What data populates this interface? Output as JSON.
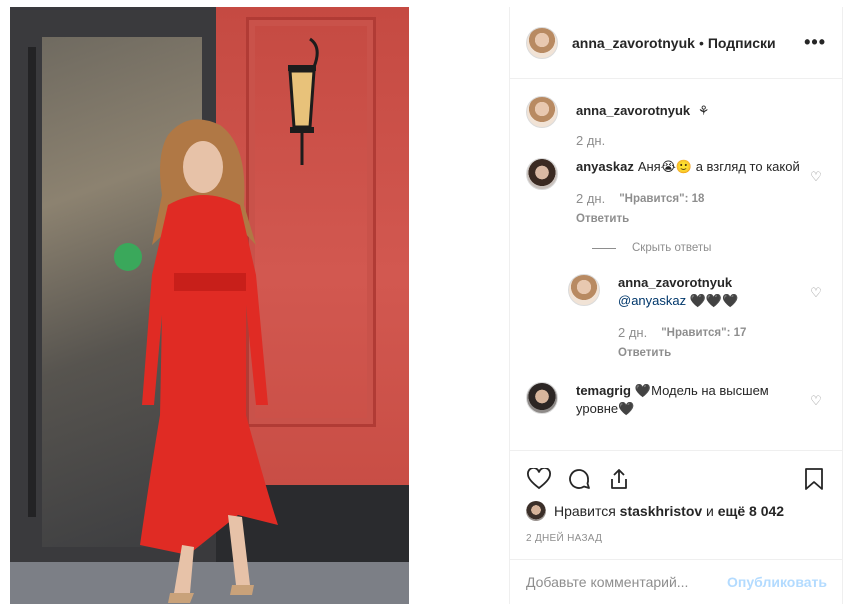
{
  "post": {
    "author": "anna_zavorotnyuk",
    "separator": "•",
    "follow_label": "Подписки",
    "more_label": "•••"
  },
  "caption": {
    "user": "anna_zavorotnyuk",
    "text": "⚘",
    "time": "2 дн."
  },
  "comments": [
    {
      "user": "anyaskaz",
      "text": "Аня😭🙂 а взгляд то какой",
      "time": "2 дн.",
      "likes": "\"Нравится\": 18",
      "reply_label": "Ответить",
      "hide_replies_label": "Скрыть ответы"
    },
    {
      "user": "anna_zavorotnyuk",
      "mention": "@anyaskaz",
      "text": "🖤🖤🖤",
      "time": "2 дн.",
      "likes": "\"Нравится\": 17",
      "reply_label": "Ответить"
    },
    {
      "user": "temagrig",
      "text": "🖤Модель на высшем уровне🖤"
    }
  ],
  "likes": {
    "prefix": "Нравится",
    "user": "staskhristov",
    "joiner": "и",
    "rest": "ещё 8 042"
  },
  "timestamp": "2 ДНЕЙ НАЗАД",
  "add_comment": {
    "placeholder": "Добавьте комментарий...",
    "publish_label": "Опубликовать"
  },
  "colors": {
    "dress": "#e02b24",
    "wall": "#c9504a",
    "link": "#00376b",
    "publish_disabled": "#b3dbff"
  },
  "icons": [
    "heart-icon",
    "comment-icon",
    "share-icon",
    "bookmark-icon",
    "more-icon"
  ]
}
